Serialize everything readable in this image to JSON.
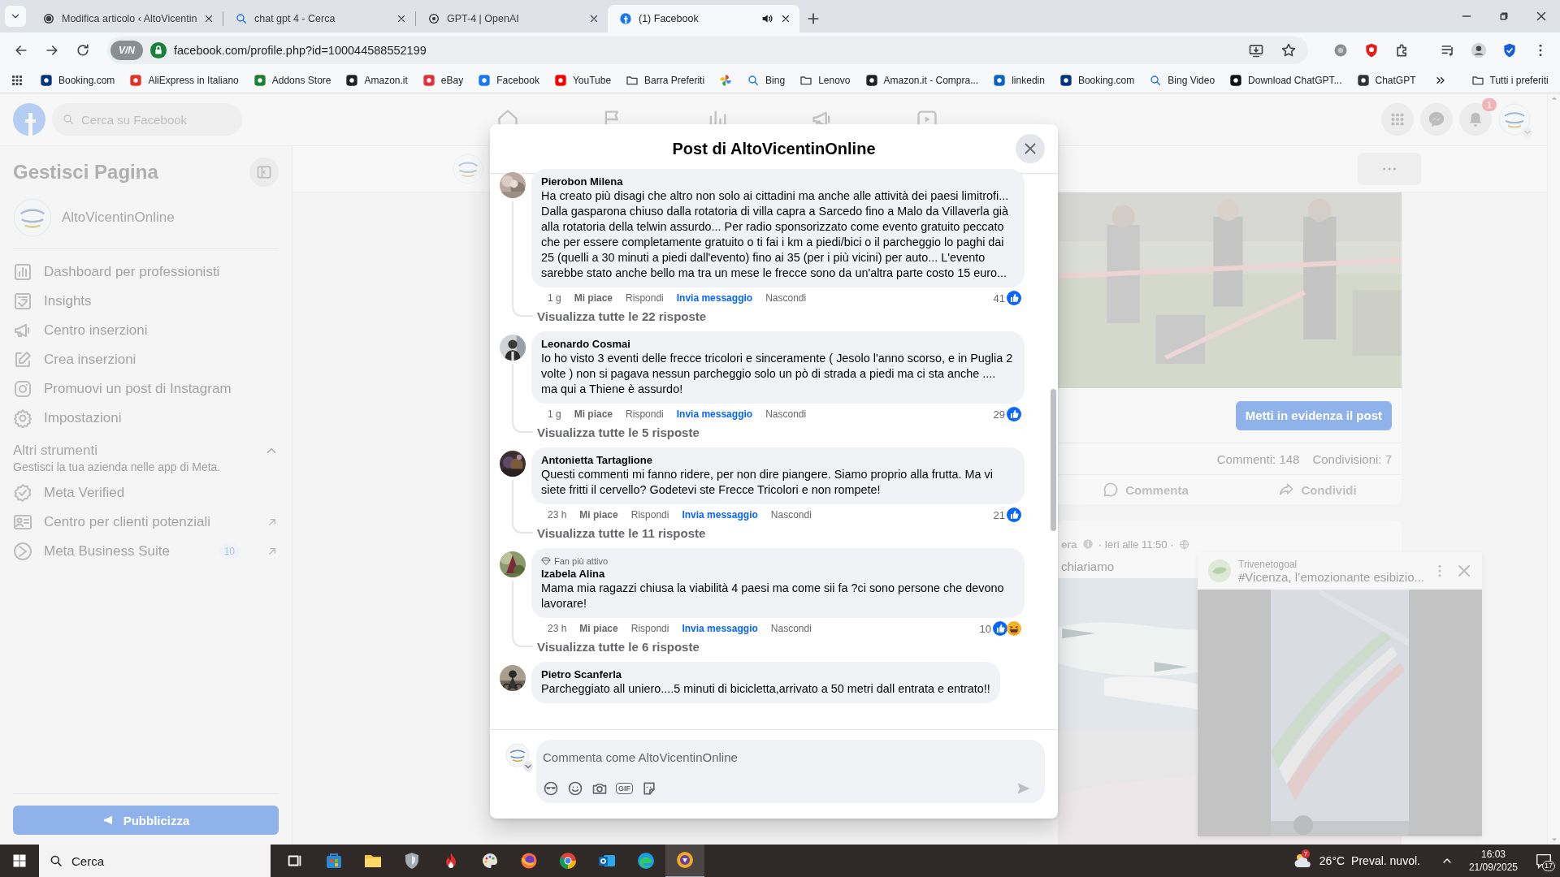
{
  "browser": {
    "tabs": [
      {
        "title": "Modifica articolo ‹ AltoVicentin",
        "selected": false,
        "audio": false
      },
      {
        "title": "chat gpt 4 - Cerca",
        "selected": false,
        "audio": false
      },
      {
        "title": "GPT-4 | OpenAI",
        "selected": false,
        "audio": false
      },
      {
        "title": "(1) Facebook",
        "selected": true,
        "audio": true
      }
    ],
    "vpn_badge": "V/N",
    "url": "facebook.com/profile.php?id=100044588552199",
    "bookmarks": [
      {
        "kind": "site",
        "label": "Booking.com"
      },
      {
        "kind": "site",
        "label": "AliExpress in Italiano"
      },
      {
        "kind": "site",
        "label": "Addons Store"
      },
      {
        "kind": "site",
        "label": "Amazon.it"
      },
      {
        "kind": "site",
        "label": "eBay"
      },
      {
        "kind": "site",
        "label": "Facebook"
      },
      {
        "kind": "site",
        "label": "YouTube"
      },
      {
        "kind": "folder",
        "label": "Barra Preferiti"
      },
      {
        "kind": "icon"
      },
      {
        "kind": "search",
        "label": "Bing"
      },
      {
        "kind": "folder",
        "label": "Lenovo"
      },
      {
        "kind": "site",
        "label": "Amazon.it - Compra..."
      },
      {
        "kind": "site",
        "label": "linkedin"
      },
      {
        "kind": "site",
        "label": "Booking.com"
      },
      {
        "kind": "search",
        "label": "Bing Video"
      },
      {
        "kind": "site",
        "label": "Download ChatGPT..."
      },
      {
        "kind": "site",
        "label": "ChatGPT"
      }
    ],
    "all_bookmarks": "Tutti i preferiti"
  },
  "facebook": {
    "search_placeholder": "Cerca su Facebook",
    "notifications_badge": "1",
    "sidebar": {
      "title": "Gestisci Pagina",
      "page_name": "AltoVicentinOnline",
      "items": [
        {
          "label": "Dashboard per professionisti"
        },
        {
          "label": "Insights"
        },
        {
          "label": "Centro inserzioni"
        },
        {
          "label": "Crea inserzioni"
        },
        {
          "label": "Promuovi un post di Instagram"
        },
        {
          "label": "Impostazioni"
        }
      ],
      "section_title": "Altri strumenti",
      "section_expanded": true,
      "section_subtitle": "Gestisci la tua azienda nelle app di Meta.",
      "tools": [
        {
          "label": "Meta Verified",
          "external": false
        },
        {
          "label": "Centro per clienti potenziali",
          "external": true
        },
        {
          "label": "Meta Business Suite",
          "badge": "10",
          "external": true
        }
      ],
      "promote_button": "Pubblicizza"
    },
    "feed": {
      "boost_button": "Metti in evidenza il post",
      "comments_count": "Commenti: 148",
      "shares_count": "Condivisioni: 7",
      "comment_action": "Commenta",
      "share_action": "Condividi",
      "next_post": {
        "author_tail": "era",
        "meta": "· Ieri alle 11:50 ·",
        "text_tail": "chiariamo"
      }
    },
    "mini_player": {
      "source": "Trivenetogoal",
      "title": "#Vicenza, l’emozionante esibizio..."
    }
  },
  "modal": {
    "title": "Post di AltoVicentinOnline",
    "comments": [
      {
        "author": "Pierobon Milena",
        "text": "Ha creato più disagi che altro non solo ai cittadini ma anche alle attività dei paesi limitrofi... Dalla gasparona chiuso dalla rotatoria di villa capra a Sarcedo fino a Malo da Villaverla già alla rotatoria della telwin assurdo... Per radio sponsorizzato come evento gratuito peccato che per essere completamente gratuito o ti fai i km a piedi/bici o il parcheggio lo paghi dai 25 (quelli a 30 minuti a piedi dall'evento) fino ai 35 (per i più vicini) per auto... L'evento sarebbe stato anche bello ma tra un mese le frecce sono da un'altra parte costo 15 euro...",
        "time": "1 g",
        "like": "Mi piace",
        "reply": "Rispondi",
        "message": "Invia messaggio",
        "hide": "Nascondi",
        "reactions_count": "41",
        "reactions": [
          {
            "kind": "like"
          }
        ],
        "replies": "Visualizza tutte le 22 risposte"
      },
      {
        "author": "Leonardo Cosmai",
        "text": "Io ho visto 3 eventi delle frecce tricolori e sinceramente ( Jesolo l'anno scorso, e in Puglia 2 volte ) non si pagava nessun parcheggio solo un pò di strada a piedi ma ci sta anche .... ma qui a Thiene è assurdo!",
        "time": "1 g",
        "like": "Mi piace",
        "reply": "Rispondi",
        "message": "Invia messaggio",
        "hide": "Nascondi",
        "reactions_count": "29",
        "reactions": [
          {
            "kind": "like"
          }
        ],
        "replies": "Visualizza tutte le 5 risposte"
      },
      {
        "author": "Antonietta Tartaglione",
        "text": "Questi commenti mi fanno ridere, per non dire piangere. Siamo proprio alla frutta. Ma vi siete fritti il cervello? Godetevi ste Frecce Tricolori e non rompete!",
        "time": "23 h",
        "like": "Mi piace",
        "reply": "Rispondi",
        "message": "Invia messaggio",
        "hide": "Nascondi",
        "reactions_count": "21",
        "reactions": [
          {
            "kind": "like"
          }
        ],
        "replies": "Visualizza tutte le 11 risposte"
      },
      {
        "badge": "Fan più attivo",
        "author": "Izabela Alina",
        "text": "Mama mia ragazzi chiusa la viabilità 4 paesi ma come sii fa ?ci sono persone che devono lavorare!",
        "time": "23 h",
        "like": "Mi piace",
        "reply": "Rispondi",
        "message": "Invia messaggio",
        "hide": "Nascondi",
        "reactions_count": "10",
        "reactions": [
          {
            "kind": "like"
          },
          {
            "kind": "haha"
          }
        ],
        "replies": "Visualizza tutte le 6 risposte"
      },
      {
        "author": "Pietro Scanferla",
        "text": "Parcheggiato all uniero....5 minuti di bicicletta,arrivato a 50 metri dall entrata e entrato!!"
      }
    ],
    "composer": {
      "placeholder": "Commenta come AltoVicentinOnline",
      "gif_label": "GIF"
    }
  },
  "taskbar": {
    "search": "Cerca",
    "weather_alert": "7",
    "temperature": "26°C",
    "weather": "Preval. nuvol.",
    "time": "16:03",
    "date": "21/09/2025",
    "notifications": "17"
  }
}
